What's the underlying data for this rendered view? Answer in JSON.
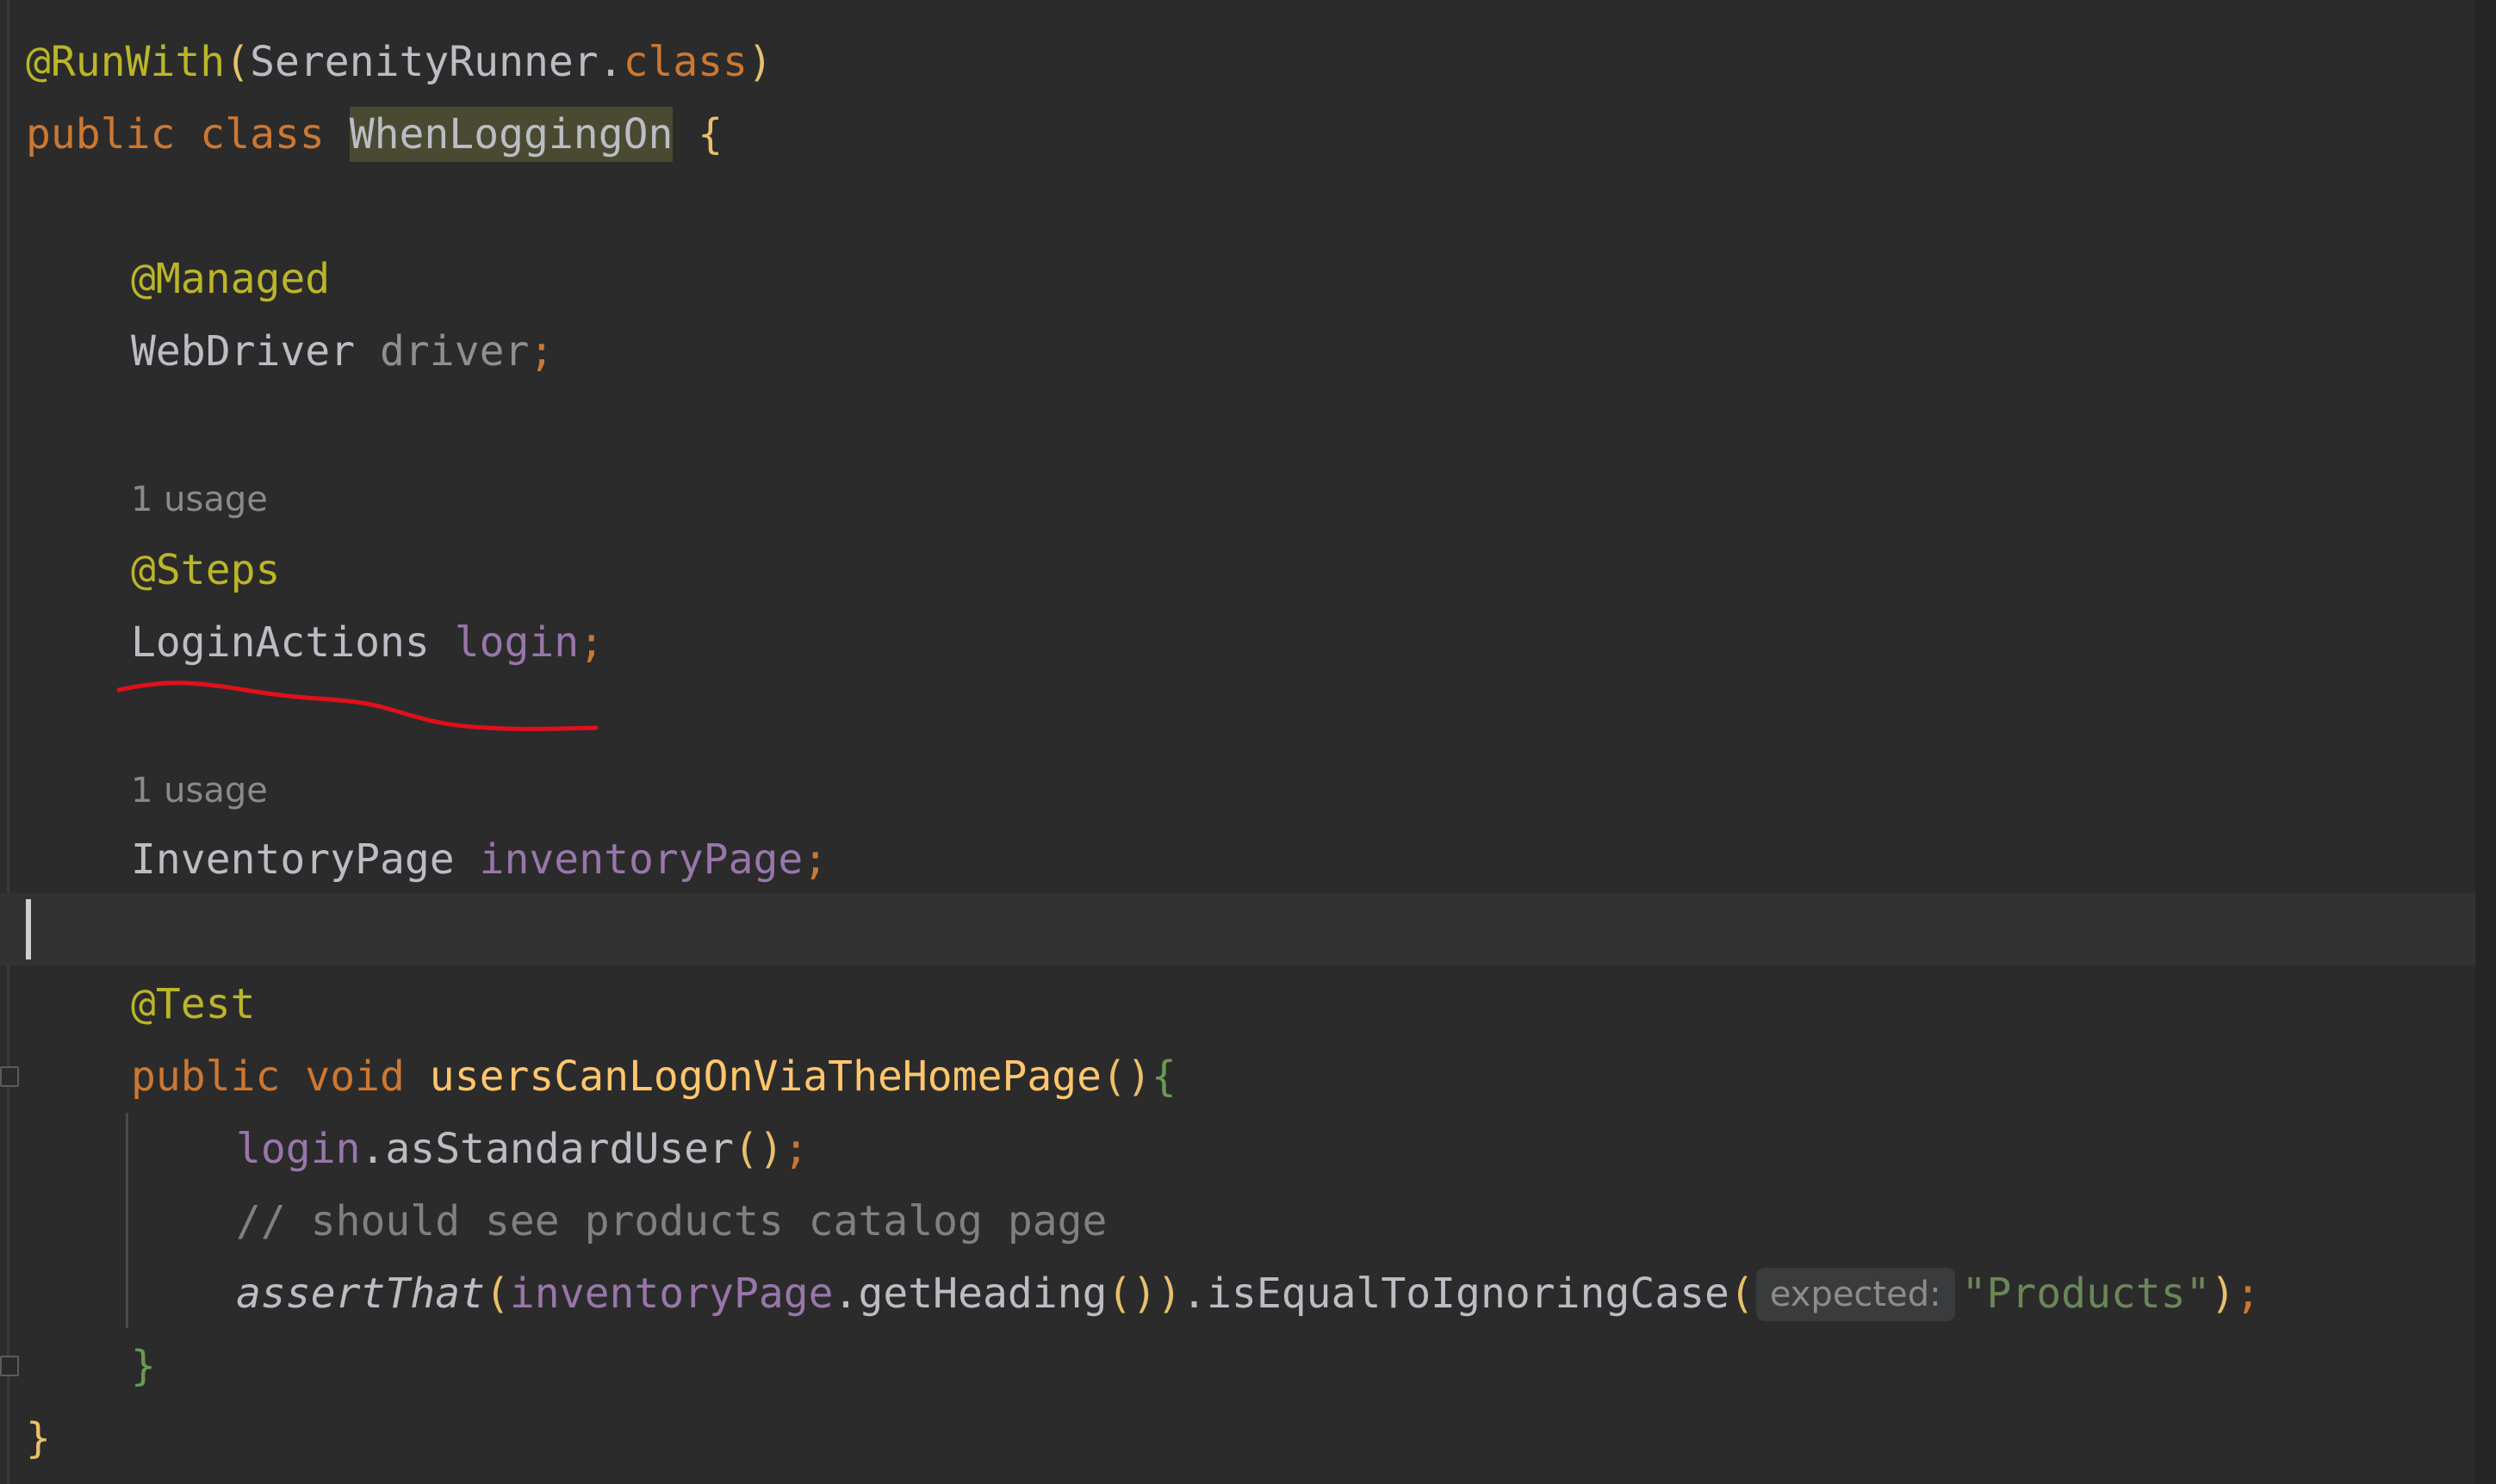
{
  "editor": {
    "lines": {
      "l1": {
        "at": "@RunWith",
        "open": "(",
        "cls": "SerenityRunner",
        "dot": ".",
        "kw": "class",
        "close": ")"
      },
      "l2": {
        "kw1": "public",
        "kw2": "class",
        "name": "WhenLoggingOn",
        "brace": "{"
      },
      "l3": {
        "at": "@Managed"
      },
      "l4": {
        "type": "WebDriver",
        "field": "driver",
        "semi": ";"
      },
      "l5_hint": "1 usage",
      "l5": {
        "at": "@Steps"
      },
      "l6": {
        "type": "LoginActions",
        "field": "login",
        "semi": ";"
      },
      "l7_hint": "1 usage",
      "l7": {
        "type": "InventoryPage",
        "field": "inventoryPage",
        "semi": ";"
      },
      "l8": {
        "at": "@Test"
      },
      "l9": {
        "kw1": "public",
        "kw2": "void",
        "method": "usersCanLogOnViaTheHomePage",
        "parens": "()",
        "brace": "{"
      },
      "l10": {
        "obj": "login",
        "call": ".asStandardUser",
        "parens": "()",
        "semi": ";"
      },
      "l11": {
        "comment": "// should see products catalog page"
      },
      "l12": {
        "fn": "assertThat",
        "open": "(",
        "obj": "inventoryPage",
        "call": ".getHeading",
        "parens": "()",
        "close": ")",
        "call2": ".isEqualToIgnoringCase",
        "open2": "(",
        "hint": "expected:",
        "str": "\"Products\"",
        "close2": ")",
        "semi": ";"
      },
      "l13": {
        "brace": "}"
      },
      "l14": {
        "brace": "}"
      }
    },
    "colors": {
      "background": "#2b2b2b",
      "annotation": "#bbb529",
      "keyword": "#cc7832",
      "field": "#9876aa",
      "method": "#ffc66d",
      "string": "#6a8759",
      "comment": "#808080",
      "annotation_underline": "#e0101a"
    }
  }
}
